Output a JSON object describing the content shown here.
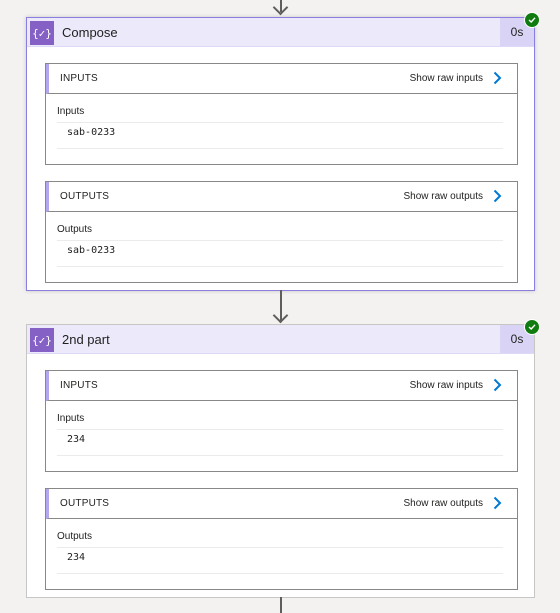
{
  "colors": {
    "accent": "#8661c5",
    "header_bg": "#ece9fb",
    "success": "#107c10",
    "link_chevron": "#0078d4"
  },
  "actions": [
    {
      "title": "Compose",
      "duration": "0s",
      "icon": "braces-icon",
      "icon_text": "{✓}",
      "status": "succeeded",
      "inputs": {
        "section_label": "INPUTS",
        "raw_link": "Show raw inputs",
        "field_label": "Inputs",
        "value": "sab-0233"
      },
      "outputs": {
        "section_label": "OUTPUTS",
        "raw_link": "Show raw outputs",
        "field_label": "Outputs",
        "value": "sab-0233"
      }
    },
    {
      "title": "2nd part",
      "duration": "0s",
      "icon": "braces-icon",
      "icon_text": "{✓}",
      "status": "succeeded",
      "inputs": {
        "section_label": "INPUTS",
        "raw_link": "Show raw inputs",
        "field_label": "Inputs",
        "value": "234"
      },
      "outputs": {
        "section_label": "OUTPUTS",
        "raw_link": "Show raw outputs",
        "field_label": "Outputs",
        "value": "234"
      }
    }
  ]
}
